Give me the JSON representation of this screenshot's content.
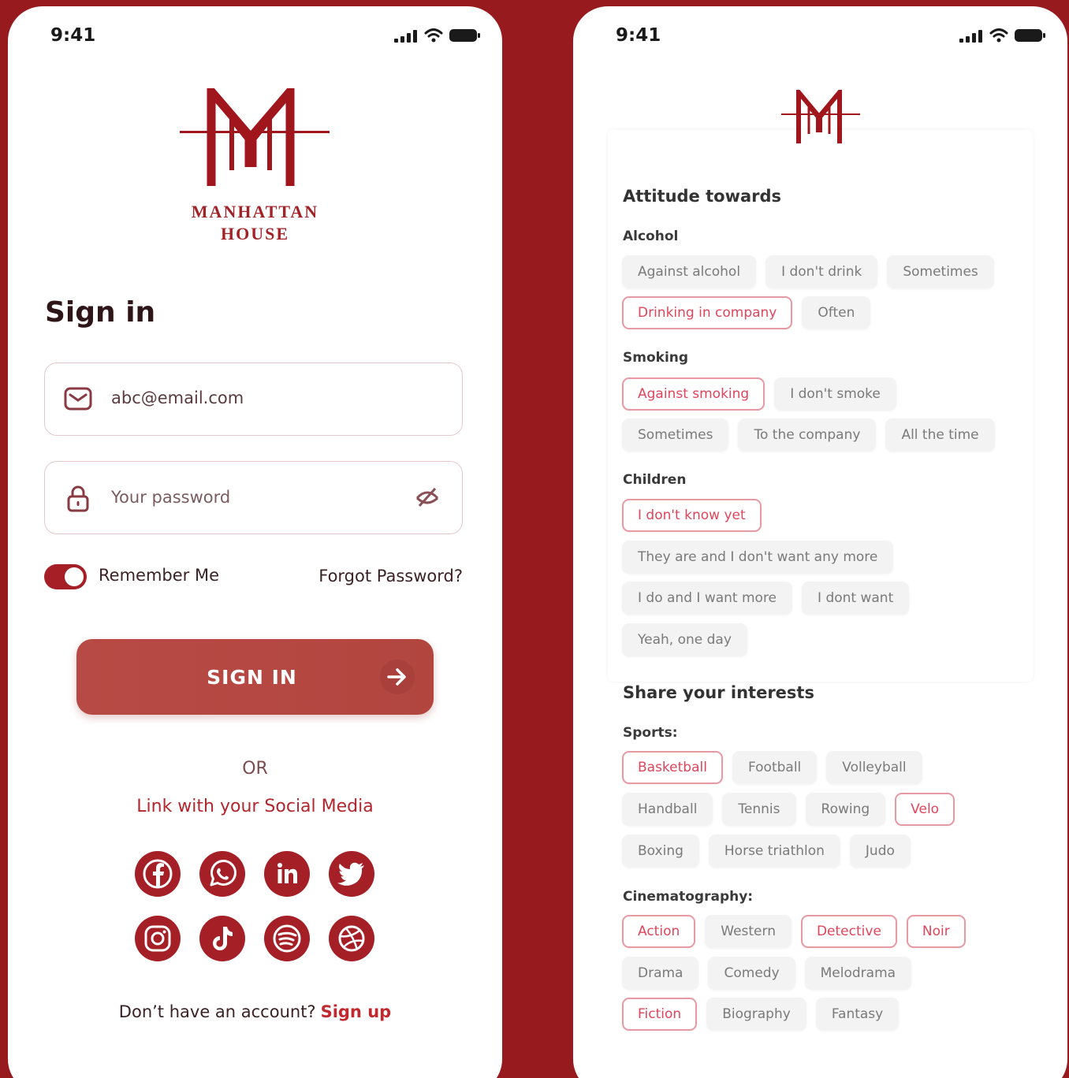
{
  "left_screen": {
    "status_time": "9:41",
    "brand": {
      "line1": "MANHATTAN",
      "line2": "HOUSE"
    },
    "title": "Sign in",
    "email": {
      "value": "abc@email.com"
    },
    "password": {
      "placeholder": "Your password"
    },
    "remember_label": "Remember Me",
    "remember_on": true,
    "forgot_label": "Forgot Password?",
    "signin_button": "SIGN IN",
    "or_text": "OR",
    "social_text": "Link with your Social Media",
    "social_icons": [
      "facebook-icon",
      "whatsapp-icon",
      "linkedin-icon",
      "twitter-icon",
      "instagram-icon",
      "tiktok-icon",
      "spotify-icon",
      "dribbble-icon"
    ],
    "no_account_text": "Don’t have an account?",
    "signup_label": "Sign up",
    "accent_color": "#a51f26"
  },
  "right_screen": {
    "status_time": "9:41",
    "attitude_title": "Attitude towards",
    "groups": [
      {
        "title": "Alcohol",
        "rows": [
          [
            {
              "label": "Against alcohol",
              "selected": false
            },
            {
              "label": "I don't drink",
              "selected": false
            },
            {
              "label": "Sometimes",
              "selected": false
            }
          ],
          [
            {
              "label": "Drinking in company",
              "selected": true
            },
            {
              "label": "Often",
              "selected": false
            }
          ]
        ]
      },
      {
        "title": "Smoking",
        "rows": [
          [
            {
              "label": "Against smoking",
              "selected": true
            },
            {
              "label": "I don't smoke",
              "selected": false
            }
          ],
          [
            {
              "label": "Sometimes",
              "selected": false
            },
            {
              "label": "To the company",
              "selected": false
            },
            {
              "label": "All the time",
              "selected": false
            }
          ]
        ]
      },
      {
        "title": "Children",
        "rows": [
          [
            {
              "label": "I don't know yet",
              "selected": true
            }
          ],
          [
            {
              "label": "They are and I don't want any more",
              "selected": false
            }
          ],
          [
            {
              "label": "I do and I want more",
              "selected": false
            },
            {
              "label": "I dont want",
              "selected": false
            }
          ],
          [
            {
              "label": "Yeah, one day",
              "selected": false
            }
          ]
        ]
      }
    ],
    "interests_title": "Share your interests",
    "interest_groups": [
      {
        "title": "Sports:",
        "rows": [
          [
            {
              "label": "Basketball",
              "selected": true
            },
            {
              "label": "Football",
              "selected": false
            },
            {
              "label": "Volleyball",
              "selected": false
            }
          ],
          [
            {
              "label": "Handball",
              "selected": false
            },
            {
              "label": "Tennis",
              "selected": false
            },
            {
              "label": "Rowing",
              "selected": false
            },
            {
              "label": "Velo",
              "selected": true
            }
          ],
          [
            {
              "label": "Boxing",
              "selected": false
            },
            {
              "label": "Horse triathlon",
              "selected": false
            },
            {
              "label": "Judo",
              "selected": false
            }
          ]
        ]
      },
      {
        "title": "Cinematography:",
        "rows": [
          [
            {
              "label": "Action",
              "selected": true
            },
            {
              "label": "Western",
              "selected": false
            },
            {
              "label": "Detective",
              "selected": true
            },
            {
              "label": "Noir",
              "selected": true
            }
          ],
          [
            {
              "label": "Drama",
              "selected": false
            },
            {
              "label": "Comedy",
              "selected": false
            },
            {
              "label": "Melodrama",
              "selected": false
            }
          ],
          [
            {
              "label": "Fiction",
              "selected": true
            },
            {
              "label": "Biography",
              "selected": false
            },
            {
              "label": "Fantasy",
              "selected": false
            }
          ]
        ]
      }
    ]
  }
}
